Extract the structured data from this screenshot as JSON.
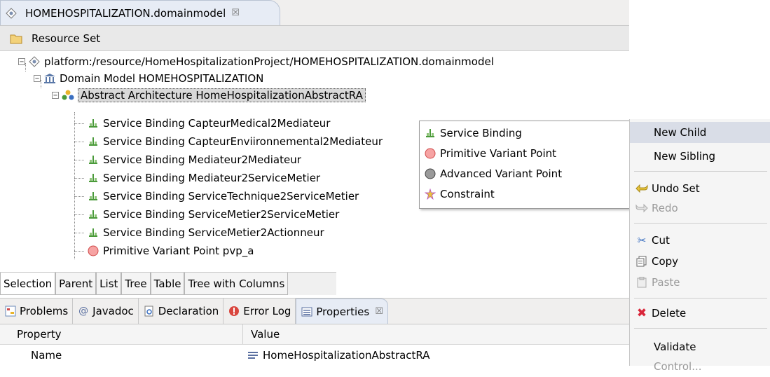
{
  "editor": {
    "tab_title": "HOMEHOSPITALIZATION.domainmodel",
    "tab_close": "☒",
    "resource_set_label": "Resource Set"
  },
  "tree": {
    "root": "platform:/resource/HomeHospitalizationProject/HOMEHOSPITALIZATION.domainmodel",
    "domain_model": "Domain Model HOMEHOSPITALIZATION",
    "abstract_architecture": "Abstract Architecture HomeHospitalizationAbstractRA",
    "children": [
      "Service Binding CapteurMedical2Mediateur",
      "Service Binding CapteurEnviironnemental2Mediateur",
      "Service Binding Mediateur2Mediateur",
      "Service Binding Mediateur2ServiceMetier",
      "Service Binding ServiceTechnique2ServiceMetier",
      "Service Binding ServiceMetier2ServiceMetier",
      "Service Binding ServiceMetier2Actionneur",
      "Primitive Variant Point pvp_a"
    ]
  },
  "bottom_tabs": [
    "Selection",
    "Parent",
    "List",
    "Tree",
    "Table",
    "Tree with Columns"
  ],
  "views": {
    "tabs": [
      "Problems",
      "Javadoc",
      "Declaration",
      "Error Log",
      "Properties"
    ],
    "properties_close": "☒"
  },
  "properties": {
    "col_property": "Property",
    "col_value": "Value",
    "row_name": "Name",
    "row_value": "HomeHospitalizationAbstractRA"
  },
  "submenu": {
    "items": [
      "Service Binding",
      "Primitive Variant Point",
      "Advanced Variant Point",
      "Constraint"
    ]
  },
  "context_menu": {
    "new_child": "New Child",
    "new_sibling": "New Sibling",
    "undo": "Undo Set",
    "redo": "Redo",
    "cut": "Cut",
    "copy": "Copy",
    "paste": "Paste",
    "delete": "Delete",
    "validate": "Validate",
    "control": "Control..."
  },
  "colors": {
    "selection": "#d9d9d9",
    "menu_highlight": "#d9dde7",
    "pvp_red": "#e85a5a",
    "binding_green": "#4a9a3a"
  }
}
